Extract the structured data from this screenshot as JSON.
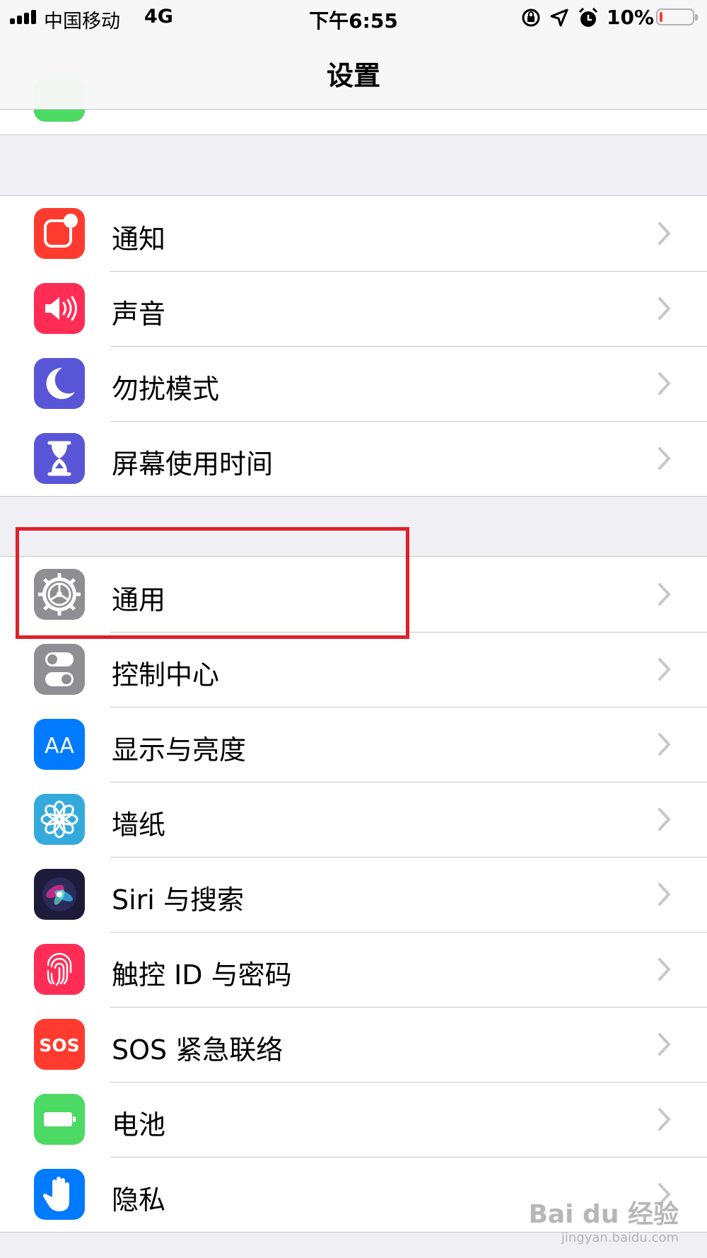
{
  "status_bar": {
    "carrier": "中国移动",
    "network": "4G",
    "time": "下午6:55",
    "battery_percent": "10%",
    "battery_level": 0.1,
    "icons": [
      "signal-icon",
      "rotation-lock-icon",
      "location-icon",
      "alarm-icon",
      "battery-icon"
    ]
  },
  "nav": {
    "title": "设置"
  },
  "group1": {
    "items": [
      {
        "label": "通知",
        "icon": "notifications-icon",
        "color": "#ff3b30"
      },
      {
        "label": "声音",
        "icon": "sounds-icon",
        "color": "#ff2d55"
      },
      {
        "label": "勿扰模式",
        "icon": "moon-icon",
        "color": "#5856d6"
      },
      {
        "label": "屏幕使用时间",
        "icon": "hourglass-icon",
        "color": "#5856d6"
      }
    ]
  },
  "group2": {
    "items": [
      {
        "label": "通用",
        "icon": "gear-icon",
        "color": "#8e8e93"
      },
      {
        "label": "控制中心",
        "icon": "toggles-icon",
        "color": "#8e8e93"
      },
      {
        "label": "显示与亮度",
        "icon": "text-size-icon",
        "color": "#007aff"
      },
      {
        "label": "墙纸",
        "icon": "flower-icon",
        "color": "#34aadc"
      },
      {
        "label": "Siri 与搜索",
        "icon": "siri-icon",
        "color": "#1c1c3a"
      },
      {
        "label": "触控 ID 与密码",
        "icon": "fingerprint-icon",
        "color": "#ff2d55"
      },
      {
        "label": "SOS 紧急联络",
        "icon": "sos-icon",
        "color": "#ff3b30"
      },
      {
        "label": "电池",
        "icon": "battery-setting-icon",
        "color": "#4cd964"
      },
      {
        "label": "隐私",
        "icon": "hand-icon",
        "color": "#007aff"
      }
    ]
  },
  "sos_icon_text": "SOS",
  "text_size_icon_text": "AA",
  "watermark": {
    "line1": "Bai du 经验",
    "line2": "jingyan.baidu.com"
  }
}
